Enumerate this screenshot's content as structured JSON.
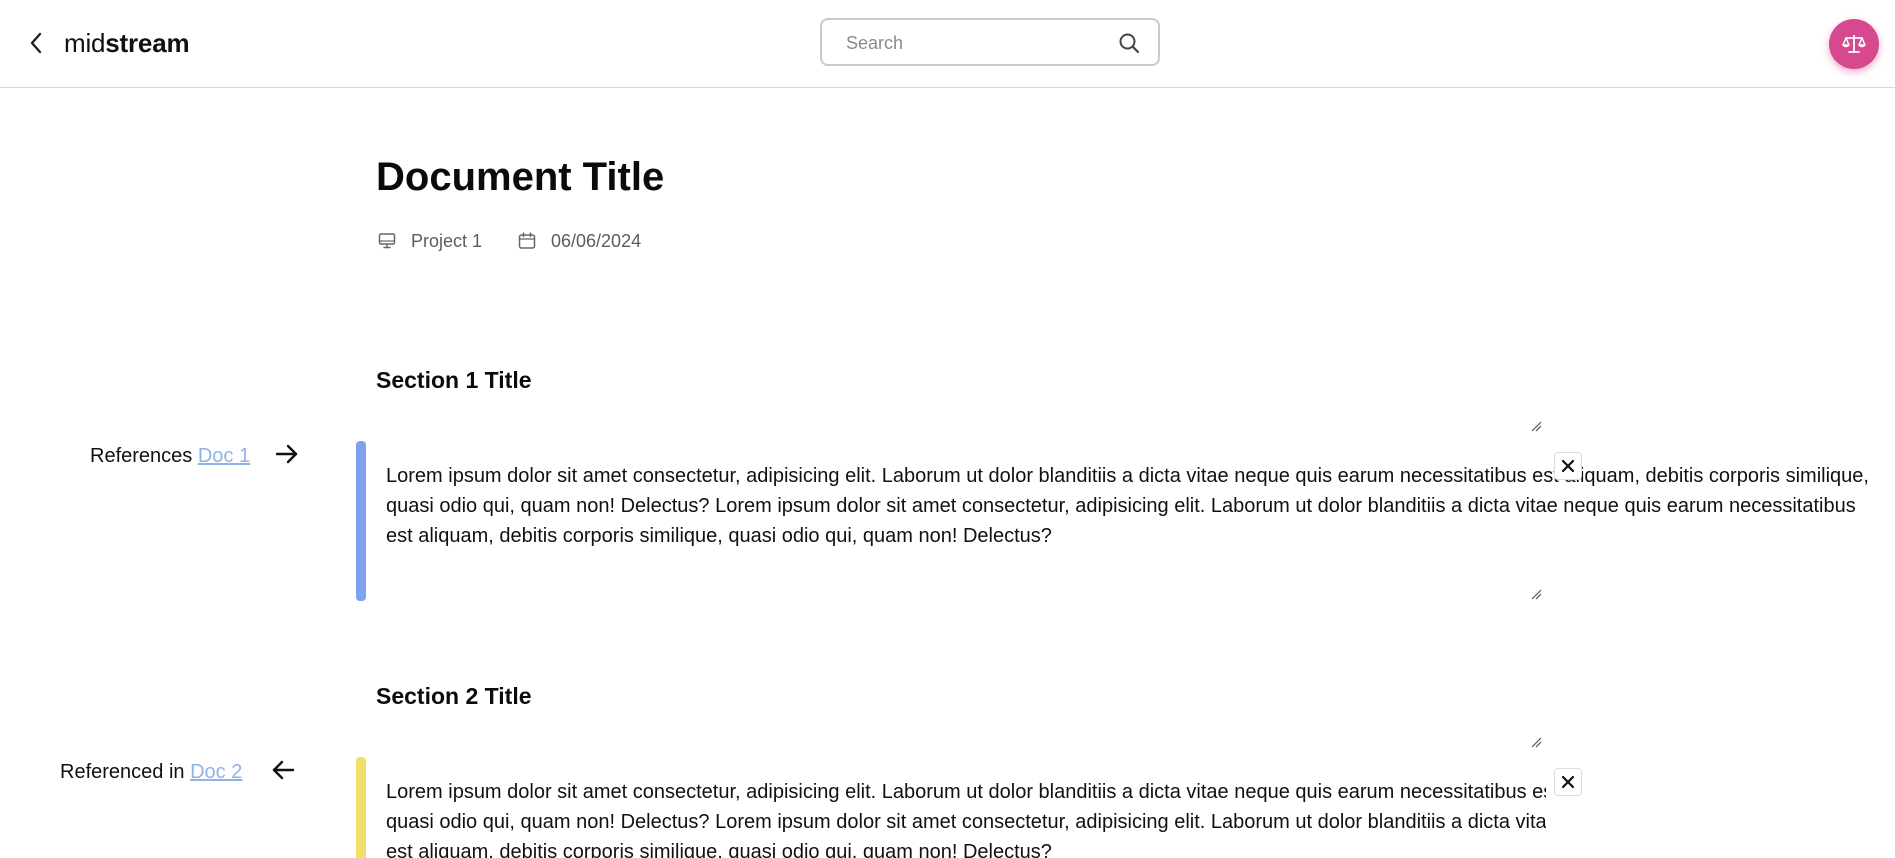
{
  "header": {
    "brand_light": "mid",
    "brand_bold": "stream",
    "search_placeholder": "Search"
  },
  "icons": {
    "back": "chevron-left-icon",
    "search": "search-icon",
    "avatar": "scales-icon",
    "project": "monitor-icon",
    "date": "calendar-icon",
    "outgoing": "arrow-right-icon",
    "incoming": "arrow-left-icon",
    "close": "close-icon"
  },
  "colors": {
    "avatar": "#d6498e",
    "link": "#8fb3e8",
    "section1_bar": "#7fa2ee",
    "section2_bar": "#f2df6a"
  },
  "document": {
    "title": "Document Title",
    "project": "Project 1",
    "date": "06/06/2024"
  },
  "sections": [
    {
      "title": "Section 1 Title",
      "ref_label": "References",
      "ref_link": "Doc 1",
      "text": "Lorem ipsum dolor sit amet consectetur, adipisicing elit. Laborum ut dolor blanditiis a dicta vitae neque quis earum necessitatibus est aliquam, debitis corporis similique, quasi odio qui, quam non! Delectus? Lorem ipsum dolor sit amet consectetur, adipisicing elit. Laborum ut dolor blanditiis a dicta vitae neque quis earum necessitatibus est aliquam, debitis corporis similique, quasi odio qui, quam non! Delectus?"
    },
    {
      "title": "Section 2 Title",
      "ref_label": "Referenced in",
      "ref_link": "Doc 2",
      "text": "Lorem ipsum dolor sit amet consectetur, adipisicing elit. Laborum ut dolor blanditiis a dicta vitae neque quis earum necessitatibus est aliquam, debitis corporis similique, quasi odio qui, quam non! Delectus? Lorem ipsum dolor sit amet consectetur, adipisicing elit. Laborum ut dolor blanditiis a dicta vitae neque quis earum necessitatibus est aliquam, debitis corporis similique, quasi odio qui, quam non! Delectus?"
    }
  ]
}
